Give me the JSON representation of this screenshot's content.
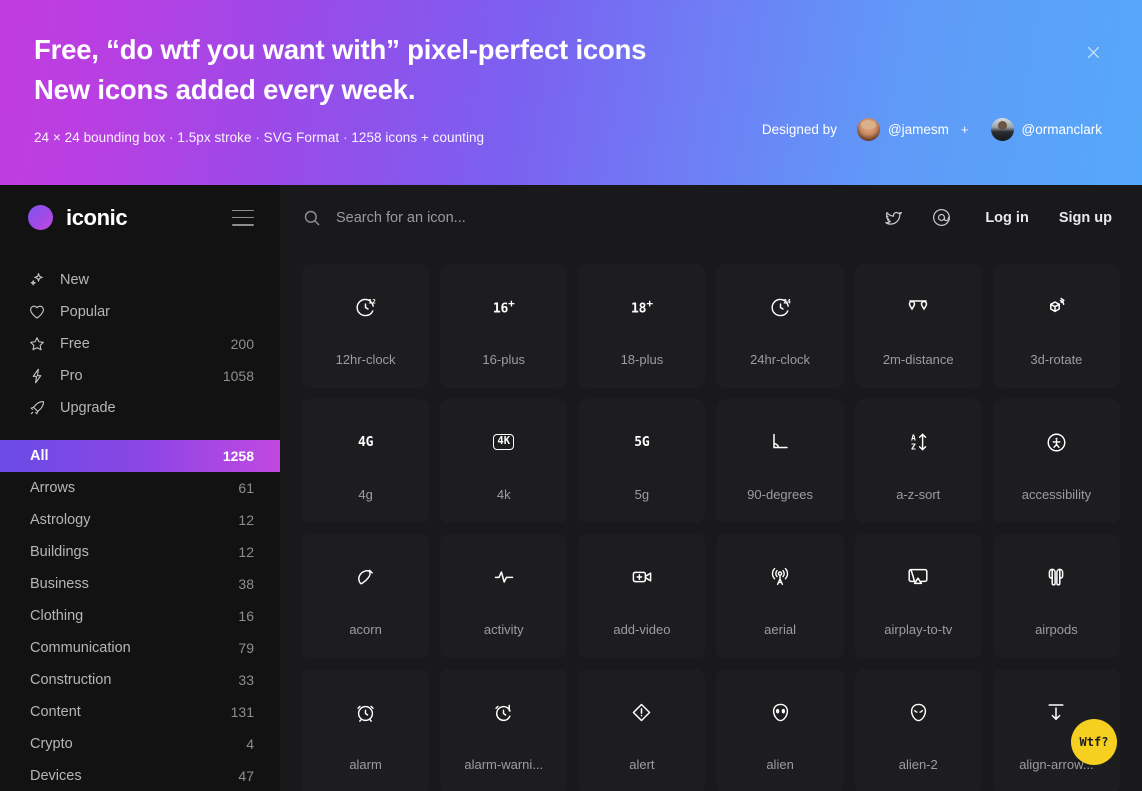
{
  "banner": {
    "headline_line1": "Free, “do wtf you want with” pixel-perfect icons",
    "headline_line2": "New icons added every week.",
    "subline": "24 × 24 bounding box · 1.5px stroke · SVG Format · 1258 icons + counting",
    "designed_by_label": "Designed by",
    "author1": "@jamesm",
    "plus": "+",
    "author2": "@ormanclark",
    "close_icon": "close-icon",
    "gradient_start": "#c13ce0",
    "gradient_end": "#55a8f9"
  },
  "sidebar": {
    "brand": "iconic",
    "menu_icon": "hamburger-icon",
    "nav": [
      {
        "label": "New",
        "icon": "sparkle-icon",
        "count": ""
      },
      {
        "label": "Popular",
        "icon": "heart-icon",
        "count": ""
      },
      {
        "label": "Free",
        "icon": "star-icon",
        "count": "200"
      },
      {
        "label": "Pro",
        "icon": "lightning-icon",
        "count": "1058"
      },
      {
        "label": "Upgrade",
        "icon": "rocket-icon",
        "count": ""
      }
    ],
    "categories": [
      {
        "label": "All",
        "count": "1258",
        "active": true
      },
      {
        "label": "Arrows",
        "count": "61",
        "active": false
      },
      {
        "label": "Astrology",
        "count": "12",
        "active": false
      },
      {
        "label": "Buildings",
        "count": "12",
        "active": false
      },
      {
        "label": "Business",
        "count": "38",
        "active": false
      },
      {
        "label": "Clothing",
        "count": "16",
        "active": false
      },
      {
        "label": "Communication",
        "count": "79",
        "active": false
      },
      {
        "label": "Construction",
        "count": "33",
        "active": false
      },
      {
        "label": "Content",
        "count": "131",
        "active": false
      },
      {
        "label": "Crypto",
        "count": "4",
        "active": false
      },
      {
        "label": "Devices",
        "count": "47",
        "active": false
      }
    ],
    "active_gradient_start": "#6a4be7",
    "active_gradient_end": "#c148e0"
  },
  "topbar": {
    "search_placeholder": "Search for an icon...",
    "search_value": "",
    "search_icon": "search-icon",
    "twitter_icon": "twitter-icon",
    "at_icon": "at-icon",
    "login": "Log in",
    "signup": "Sign up"
  },
  "grid": {
    "icons": [
      {
        "name": "12hr-clock",
        "glyph": "clock-12-icon"
      },
      {
        "name": "16-plus",
        "glyph": "16-plus-icon",
        "text": "16",
        "sup": "+"
      },
      {
        "name": "18-plus",
        "glyph": "18-plus-icon",
        "text": "18",
        "sup": "+"
      },
      {
        "name": "24hr-clock",
        "glyph": "clock-24-icon"
      },
      {
        "name": "2m-distance",
        "glyph": "2m-distance-icon"
      },
      {
        "name": "3d-rotate",
        "glyph": "3d-rotate-icon"
      },
      {
        "name": "4g",
        "glyph": "4g-icon",
        "text": "4G"
      },
      {
        "name": "4k",
        "glyph": "4k-icon",
        "text": "4K"
      },
      {
        "name": "5g",
        "glyph": "5g-icon",
        "text": "5G"
      },
      {
        "name": "90-degrees",
        "glyph": "90-degrees-icon"
      },
      {
        "name": "a-z-sort",
        "glyph": "a-z-sort-icon"
      },
      {
        "name": "accessibility",
        "glyph": "accessibility-icon"
      },
      {
        "name": "acorn",
        "glyph": "acorn-icon"
      },
      {
        "name": "activity",
        "glyph": "activity-icon"
      },
      {
        "name": "add-video",
        "glyph": "add-video-icon"
      },
      {
        "name": "aerial",
        "glyph": "aerial-icon"
      },
      {
        "name": "airplay-to-tv",
        "glyph": "airplay-to-tv-icon"
      },
      {
        "name": "airpods",
        "glyph": "airpods-icon"
      },
      {
        "name": "alarm",
        "glyph": "alarm-icon"
      },
      {
        "name": "alarm-warni...",
        "glyph": "alarm-warning-icon"
      },
      {
        "name": "alert",
        "glyph": "alert-icon"
      },
      {
        "name": "alien",
        "glyph": "alien-icon"
      },
      {
        "name": "alien-2",
        "glyph": "alien-2-icon"
      },
      {
        "name": "align-arrow...",
        "glyph": "align-arrow-down-icon"
      }
    ]
  },
  "fab": {
    "label": "Wtf?",
    "color": "#f5d020"
  }
}
